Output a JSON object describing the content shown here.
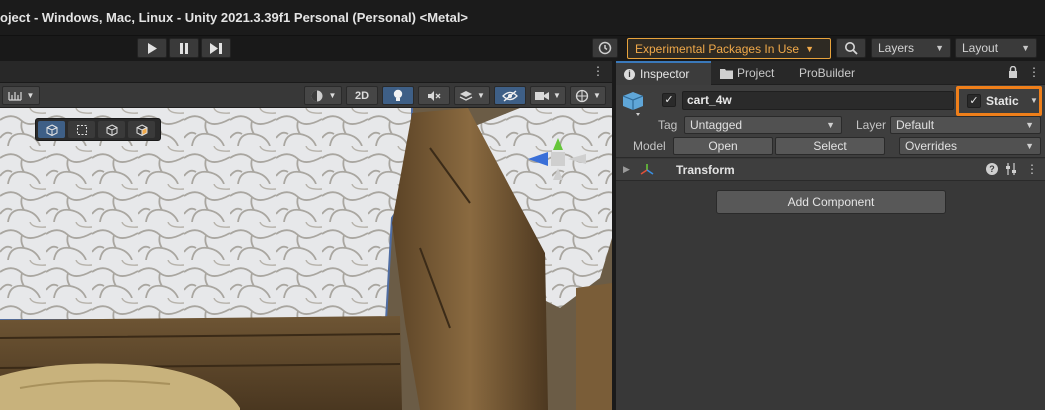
{
  "window": {
    "title": "oject - Windows, Mac, Linux - Unity 2021.3.39f1 Personal (Personal) <Metal>"
  },
  "toolbar": {
    "play_icon": "play-icon",
    "pause_icon": "pause-icon",
    "step_icon": "step-icon",
    "experimental_label": "Experimental Packages In Use",
    "layers_label": "Layers",
    "layout_label": "Layout"
  },
  "scene_toolbar": {
    "mode_2d": "2D"
  },
  "inspector": {
    "tabs": [
      {
        "label": "Inspector"
      },
      {
        "label": "Project"
      },
      {
        "label": "ProBuilder"
      }
    ],
    "object_name": "cart_4w",
    "static_label": "Static",
    "tag_label": "Tag",
    "tag_value": "Untagged",
    "layer_label": "Layer",
    "layer_value": "Default",
    "model_label": "Model",
    "open_label": "Open",
    "select_label": "Select",
    "overrides_label": "Overrides",
    "transform_label": "Transform",
    "add_component_label": "Add Component"
  },
  "colors": {
    "accent_orange": "#ef7f1a",
    "experimental_text": "#f0a94a",
    "tab_active": "#3a79bb"
  }
}
